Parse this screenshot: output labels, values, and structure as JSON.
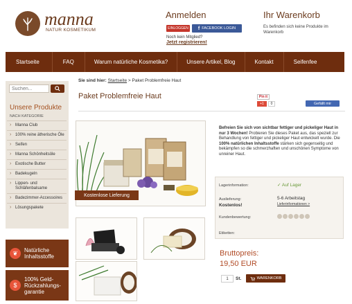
{
  "brand": {
    "name": "manna",
    "subtitle": "NATUR KOSMETIKUM"
  },
  "login": {
    "title": "Anmelden",
    "login_btn": "EINLOGGEN",
    "fb_btn": "FACEBOOK LOGIN",
    "not_member": "Noch kein Mitglied?",
    "register": "Jetzt registrieren!"
  },
  "cart": {
    "title": "Ihr Warenkorb",
    "text": "Es befinden sich keine Produkte im Warenkorb"
  },
  "nav": {
    "items": [
      "Startseite",
      "FAQ",
      "Warum natürliche Kosmetika?",
      "Unsere Artikel, Blog",
      "Kontakt",
      "Seifenfee"
    ]
  },
  "sidebar": {
    "search_placeholder": "Suchen...",
    "products_title": "Unsere Produkte",
    "products_sub": "NACH KATEGORIE",
    "categories": [
      "Manna Club",
      "100% reine ätherische Öle",
      "Seifen",
      "Manna Schönheitsöle",
      "Exotische Butter",
      "Badekugeln",
      "Lippen- und Schläfenbalsame",
      "Badezimmer-Accessoires",
      "Lösungspakete"
    ],
    "badges": [
      {
        "line1": "Natürliche",
        "line2": "Inhaltsstoffe"
      },
      {
        "line1": "100% Geld-",
        "line2": "Rückzahlungs-",
        "line3": "garantie"
      }
    ]
  },
  "breadcrumb": {
    "prefix": "Sie sind hier:",
    "home": "Startseite",
    "sep": ">",
    "current": "Paket Problemfreie Haut"
  },
  "product": {
    "title": "Paket Problemfreie Haut",
    "ribbon": "Kostenlose Lieferung",
    "desc_bold": "Befreien Sie sich von sichtbar fettiger und pickeliger Haut in nur 3 Wochen!",
    "desc_text1": " Probieren Sie dieses Paket aus, das speziell zur Behandlung von fettiger und pickeliger Haut entwickelt wurde. Die ",
    "desc_bold2": "100% natürlichen Inhaltsstoffe",
    "desc_text2": " stärken sich gegenseitig und bekämpfen so die schmerzhaften und unschönen Symptome von unreiner Haut.",
    "stock_label": "Lagerinformation:",
    "stock_value": "Auf Lager",
    "delivery_label": "Auslieferung:",
    "delivery_free": "Kostenlos!",
    "delivery_days": "5-6 Arbeitstag",
    "delivery_link": "Lieferinformationen >",
    "rating_label": "Kundenbewertung:",
    "labels_label": "Etiketten:",
    "price_label": "Bruttopreis:",
    "price": "19,50 EUR",
    "qty": "1",
    "unit": "St.",
    "cart_btn": "WARENKORB"
  },
  "social": {
    "pinit": "Pin it",
    "gplus": "+1",
    "gcount": "0",
    "fb": "Gefällt mir"
  }
}
